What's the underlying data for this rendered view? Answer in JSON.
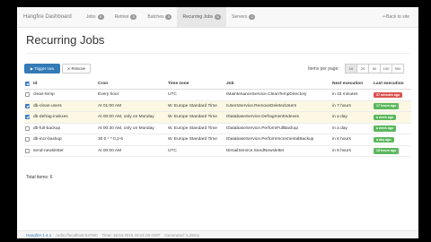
{
  "navbar": {
    "brand": "Hangfire Dashboard",
    "items": [
      {
        "label": "Jobs",
        "count": "0"
      },
      {
        "label": "Retries",
        "count": "0"
      },
      {
        "label": "Batches",
        "count": "0"
      },
      {
        "label": "Recurring Jobs",
        "count": "6"
      },
      {
        "label": "Servers",
        "count": "1"
      }
    ],
    "back_label": "Back to site"
  },
  "page": {
    "title": "Recurring Jobs"
  },
  "toolbar": {
    "trigger_label": "Trigger now",
    "remove_label": "Remove",
    "items_per_page_label": "Items per page:",
    "page_sizes": [
      "10",
      "20",
      "50",
      "100",
      "500"
    ],
    "selected_page_size": "10"
  },
  "table": {
    "headers": {
      "id": "Id",
      "cron": "Cron",
      "timezone": "Time zone",
      "job": "Job",
      "next": "Next execution",
      "last": "Last execution"
    },
    "rows": [
      {
        "checked": false,
        "id": "clean-temp",
        "cron": "Every hour",
        "timezone": "UTC",
        "job": "IMaintenanceService.CleanTempDirectory",
        "next": "in 33 minutes",
        "last": "37 minutes ago",
        "last_color": "#d9534f"
      },
      {
        "checked": true,
        "id": "db-clean-users",
        "cron": "At 01:00 AM",
        "timezone": "W. Europe Standard Time",
        "job": "IUsersService.RemoveDeletedUsers",
        "next": "in 7 hours",
        "last": "17 hours ago",
        "last_color": "#5cb85c"
      },
      {
        "checked": true,
        "id": "db-defrag-indexes",
        "cron": "At 00:00 AM, only on Monday",
        "timezone": "W. Europe Standard Time",
        "job": "IDatabaseService.DefragmentIndexes",
        "next": "in a day",
        "last": "a week ago",
        "last_color": "#5cb85c"
      },
      {
        "checked": false,
        "id": "db-full-backup",
        "cron": "At 00:30 AM, only on Monday",
        "timezone": "W. Europe Standard Time",
        "job": "IDatabaseService.PerformFullBackup",
        "next": "in a day",
        "last": "a week ago",
        "last_color": "#5cb85c"
      },
      {
        "checked": false,
        "id": "db-incr-backup",
        "cron": "30 0 * * 0,2-6",
        "timezone": "W. Europe Standard Time",
        "job": "IDatabaseService.PerformIncrementalBackup",
        "next": "in 6 hours",
        "last": "a day ago",
        "last_color": "#5cb85c"
      },
      {
        "checked": false,
        "id": "send-newsletter",
        "cron": "At 00:00 AM",
        "timezone": "UTC",
        "job": "IEmailService.SendNewsletter",
        "next": "in 8 hours",
        "last": "15 hours ago",
        "last_color": "#5cb85c"
      }
    ],
    "total": "Total items: 6"
  },
  "footer": {
    "version": "Hangfire 1.4.1",
    "redis": "redis://localhost:6379/0",
    "time": "Time: 18.04.2015 16:21:00 GMT",
    "generated": "Generated: 5,28ms"
  },
  "colors": {
    "primary": "#337ab7",
    "highlight_row": "#fcf8e3",
    "danger": "#d9534f",
    "success": "#5cb85c"
  }
}
